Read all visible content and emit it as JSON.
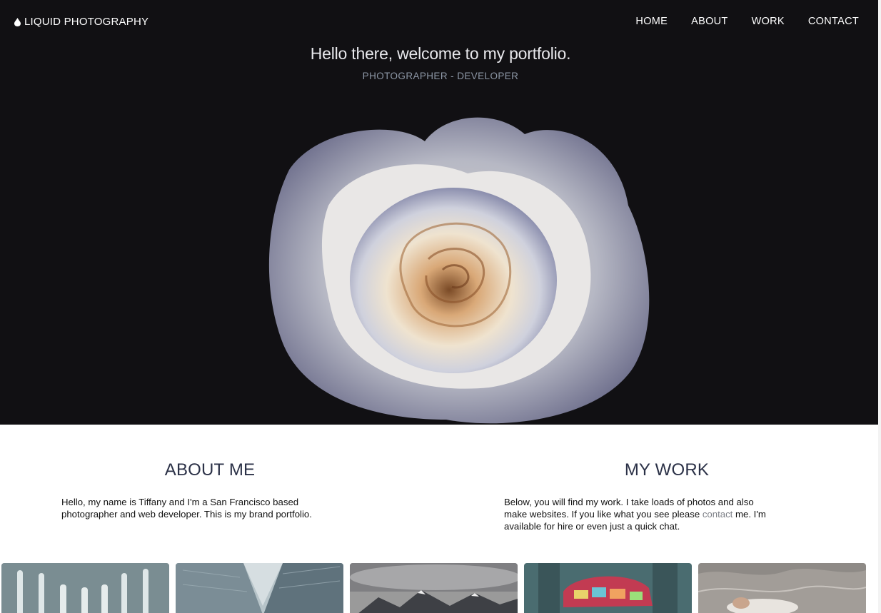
{
  "brand": {
    "name": "LIQUID PHOTOGRAPHY",
    "icon": "water-drop-icon"
  },
  "nav": {
    "items": [
      "HOME",
      "ABOUT",
      "WORK",
      "CONTACT"
    ]
  },
  "hero": {
    "title": "Hello there, welcome to my portfolio.",
    "subtitle": "PHOTOGRAPHER - DEVELOPER"
  },
  "about": {
    "title": "ABOUT ME",
    "text": "Hello, my name is Tiffany and I'm a San Francisco based photographer and web developer. This is my brand portfolio."
  },
  "work": {
    "title": "MY WORK",
    "text_before": "Below, you will find my work. I take loads of photos and also make websites. If you like what you see please ",
    "link": "contact",
    "text_after": " me. I'm available for hire or even just a quick chat."
  },
  "colors": {
    "hero_bg": "#111013",
    "heading": "#2b3147",
    "subtitle": "#8d97a6",
    "link": "#7c7f86"
  }
}
